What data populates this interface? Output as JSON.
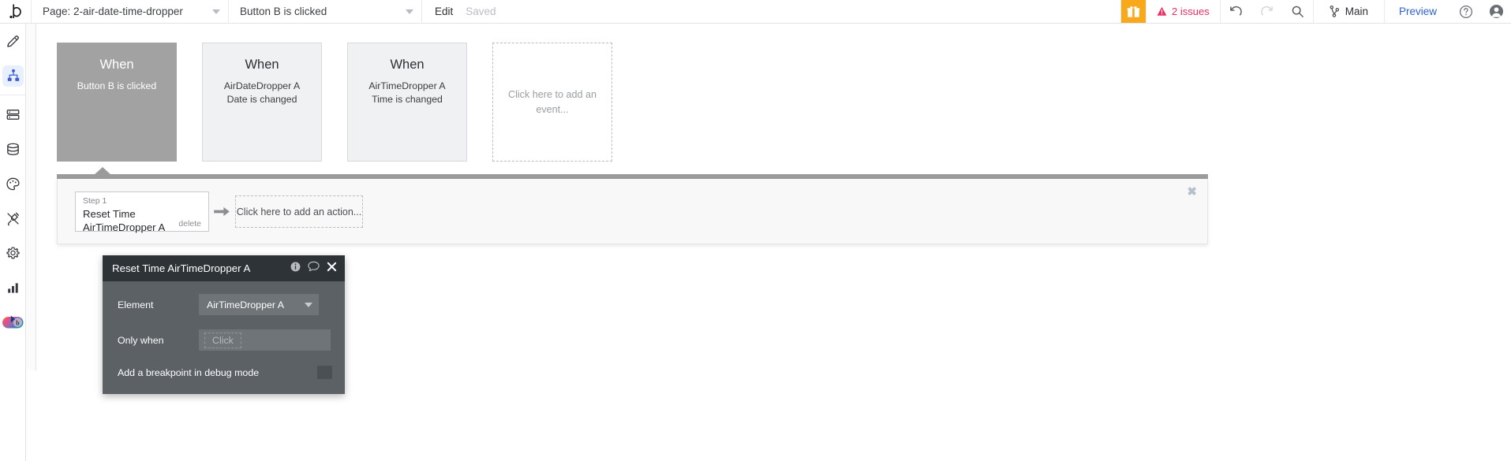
{
  "topbar": {
    "logo": "b",
    "page_select": {
      "label": "Page: 2-air-date-time-dropper",
      "caret": "chevron-down-icon"
    },
    "event_select": {
      "label": "Button B is clicked",
      "caret": "chevron-down-icon"
    },
    "edit_label": "Edit",
    "saved_label": "Saved",
    "gift_icon": "gift-icon",
    "issues_label": "2 issues",
    "issues_color": "#ec2d62",
    "gift_bg": "#f8a91b",
    "undo_icon": "undo-icon",
    "redo_icon": "redo-icon",
    "search_icon": "search-icon",
    "branch_icon": "branch-icon",
    "branch_label": "Main",
    "preview_label": "Preview",
    "preview_color": "#2d5fd6",
    "help_icon": "help-circle-icon",
    "user_icon": "user-avatar-icon"
  },
  "sidebar": {
    "items": [
      {
        "name": "design",
        "icon": "pencil-icon",
        "selected": false
      },
      {
        "name": "workflow",
        "icon": "workflow-icon",
        "selected": true
      },
      {
        "name": "data",
        "icon": "data-icon",
        "selected": false
      },
      {
        "name": "database",
        "icon": "database-icon",
        "selected": false
      },
      {
        "name": "styles",
        "icon": "palette-icon",
        "selected": false
      },
      {
        "name": "plugins",
        "icon": "plug-icon",
        "selected": false
      },
      {
        "name": "settings",
        "icon": "gear-icon",
        "selected": false
      },
      {
        "name": "logs",
        "icon": "bar-chart-icon",
        "selected": false
      }
    ],
    "toggle_pill": "bubble-toggle-icon",
    "expander": "expand-right-icon",
    "selected_bg": "#e8f0fe",
    "selected_fg": "#3f5dd3"
  },
  "events": [
    {
      "when": "When",
      "desc": "Button B is clicked",
      "active": true,
      "placeholder": false
    },
    {
      "when": "When",
      "desc": "AirDateDropper A\nDate is changed",
      "active": false,
      "placeholder": false
    },
    {
      "when": "When",
      "desc": "AirTimeDropper A\nTime is changed",
      "active": false,
      "placeholder": false
    },
    {
      "when": "",
      "desc": "Click here to add an event...",
      "active": false,
      "placeholder": true
    }
  ],
  "workflow": {
    "close_icon": "close-icon",
    "step": {
      "number": "Step 1",
      "title": "Reset Time AirTimeDropper A",
      "delete_label": "delete"
    },
    "arrow_icon": "arrow-right-icon",
    "add_action_label": "Click here to add an action..."
  },
  "property_editor": {
    "title": "Reset Time AirTimeDropper A",
    "info_icon": "info-icon",
    "comment_icon": "comment-icon",
    "close_icon": "close-icon",
    "element_label": "Element",
    "element_value": "AirTimeDropper A",
    "only_when_label": "Only when",
    "only_when_placeholder": "Click",
    "breakpoint_label": "Add a breakpoint in debug mode",
    "breakpoint_checked": false,
    "header_bg": "#2e3338",
    "body_bg": "#5b6165"
  }
}
